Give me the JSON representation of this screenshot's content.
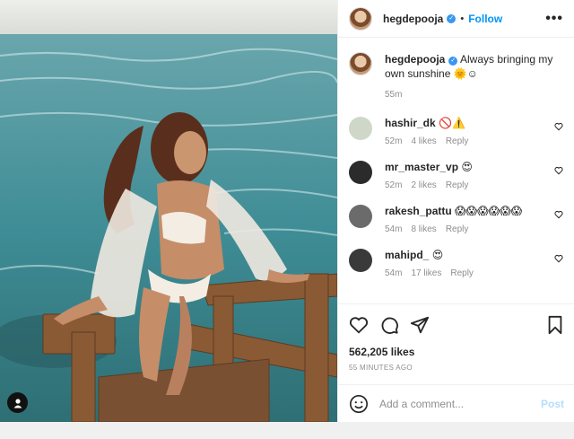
{
  "post": {
    "username": "hegdepooja",
    "verified_icon": "verified-badge-icon",
    "follow_label": "Follow",
    "header_dot": "•",
    "more_label": "•••",
    "caption_text": "Always bringing my own sunshine 🌞☺",
    "caption_time": "55m",
    "likes": "562,205 likes",
    "posted_ago": "55 MINUTES AGO",
    "comment_placeholder": "Add a comment...",
    "post_label": "Post"
  },
  "comments": [
    {
      "user": "hashir_dk",
      "text": "🚫⚠️",
      "time": "52m",
      "likes": "4 likes",
      "reply": "Reply",
      "avatar_color": "#cfd8c8"
    },
    {
      "user": "mr_master_vp",
      "text": "😍",
      "time": "52m",
      "likes": "2 likes",
      "reply": "Reply",
      "avatar_color": "#2b2b2b"
    },
    {
      "user": "rakesh_pattu",
      "text": "😱😱😱😱😱😱",
      "time": "54m",
      "likes": "8 likes",
      "reply": "Reply",
      "avatar_color": "#6b6b6b"
    },
    {
      "user": "mahipd_",
      "text": "😍",
      "time": "54m",
      "likes": "17 likes",
      "reply": "Reply",
      "avatar_color": "#3a3a3a"
    }
  ],
  "colors": {
    "accent": "#0095f6",
    "post_disabled": "#b2dffc",
    "muted": "#8e8e8e"
  }
}
